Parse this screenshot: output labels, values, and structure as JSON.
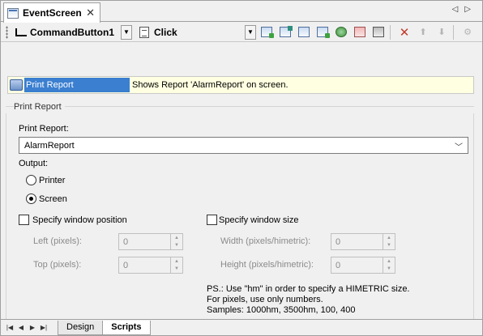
{
  "document_tab": {
    "title": "EventScreen",
    "close_glyph": "✕"
  },
  "tab_nav": {
    "prev": "◁",
    "next": "▷"
  },
  "toolbar": {
    "object_name": "CommandButton1",
    "event_name": "Click",
    "icons": [
      "insert-icon",
      "add-icon",
      "form-icon",
      "edit-icon",
      "globe-icon",
      "refresh-icon",
      "print-icon"
    ],
    "delete_glyph": "✕",
    "up_glyph": "⬆",
    "down_glyph": "⬇"
  },
  "info_bar": {
    "action_name": "Print Report",
    "description": "Shows Report 'AlarmReport' on screen."
  },
  "group": {
    "title": "Print Report",
    "report_label": "Print Report:",
    "report_value": "AlarmReport",
    "output_label": "Output:",
    "output_options": [
      {
        "label": "Printer",
        "selected": false
      },
      {
        "label": "Screen",
        "selected": true
      }
    ],
    "window_position": {
      "label": "Specify window position",
      "checked": false,
      "left_label": "Left (pixels):",
      "left_value": "0",
      "top_label": "Top (pixels):",
      "top_value": "0"
    },
    "window_size": {
      "label": "Specify window size",
      "checked": false,
      "width_label": "Width (pixels/himetric):",
      "width_value": "0",
      "height_label": "Height (pixels/himetric):",
      "height_value": "0"
    },
    "note_lines": [
      "PS.: Use \"hm\" in order to specify a HIMETRIC size.",
      "For pixels, use only numbers.",
      "Samples: 1000hm, 3500hm, 100, 400"
    ]
  },
  "bottom_tabs": {
    "nav": [
      "|◀",
      "◀",
      "▶",
      "▶|"
    ],
    "tabs": [
      {
        "label": "Design",
        "active": false
      },
      {
        "label": "Scripts",
        "active": true
      }
    ]
  }
}
